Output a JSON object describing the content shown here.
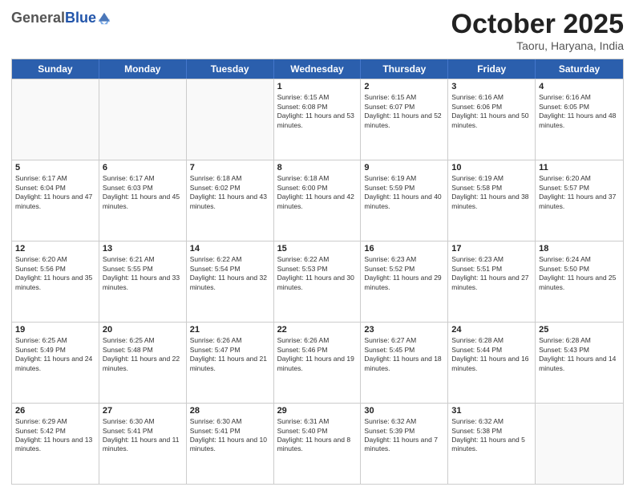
{
  "logo": {
    "general": "General",
    "blue": "Blue"
  },
  "header": {
    "month": "October 2025",
    "location": "Taoru, Haryana, India"
  },
  "weekdays": [
    "Sunday",
    "Monday",
    "Tuesday",
    "Wednesday",
    "Thursday",
    "Friday",
    "Saturday"
  ],
  "rows": [
    [
      {
        "day": "",
        "sunrise": "",
        "sunset": "",
        "daylight": ""
      },
      {
        "day": "",
        "sunrise": "",
        "sunset": "",
        "daylight": ""
      },
      {
        "day": "",
        "sunrise": "",
        "sunset": "",
        "daylight": ""
      },
      {
        "day": "1",
        "sunrise": "Sunrise: 6:15 AM",
        "sunset": "Sunset: 6:08 PM",
        "daylight": "Daylight: 11 hours and 53 minutes."
      },
      {
        "day": "2",
        "sunrise": "Sunrise: 6:15 AM",
        "sunset": "Sunset: 6:07 PM",
        "daylight": "Daylight: 11 hours and 52 minutes."
      },
      {
        "day": "3",
        "sunrise": "Sunrise: 6:16 AM",
        "sunset": "Sunset: 6:06 PM",
        "daylight": "Daylight: 11 hours and 50 minutes."
      },
      {
        "day": "4",
        "sunrise": "Sunrise: 6:16 AM",
        "sunset": "Sunset: 6:05 PM",
        "daylight": "Daylight: 11 hours and 48 minutes."
      }
    ],
    [
      {
        "day": "5",
        "sunrise": "Sunrise: 6:17 AM",
        "sunset": "Sunset: 6:04 PM",
        "daylight": "Daylight: 11 hours and 47 minutes."
      },
      {
        "day": "6",
        "sunrise": "Sunrise: 6:17 AM",
        "sunset": "Sunset: 6:03 PM",
        "daylight": "Daylight: 11 hours and 45 minutes."
      },
      {
        "day": "7",
        "sunrise": "Sunrise: 6:18 AM",
        "sunset": "Sunset: 6:02 PM",
        "daylight": "Daylight: 11 hours and 43 minutes."
      },
      {
        "day": "8",
        "sunrise": "Sunrise: 6:18 AM",
        "sunset": "Sunset: 6:00 PM",
        "daylight": "Daylight: 11 hours and 42 minutes."
      },
      {
        "day": "9",
        "sunrise": "Sunrise: 6:19 AM",
        "sunset": "Sunset: 5:59 PM",
        "daylight": "Daylight: 11 hours and 40 minutes."
      },
      {
        "day": "10",
        "sunrise": "Sunrise: 6:19 AM",
        "sunset": "Sunset: 5:58 PM",
        "daylight": "Daylight: 11 hours and 38 minutes."
      },
      {
        "day": "11",
        "sunrise": "Sunrise: 6:20 AM",
        "sunset": "Sunset: 5:57 PM",
        "daylight": "Daylight: 11 hours and 37 minutes."
      }
    ],
    [
      {
        "day": "12",
        "sunrise": "Sunrise: 6:20 AM",
        "sunset": "Sunset: 5:56 PM",
        "daylight": "Daylight: 11 hours and 35 minutes."
      },
      {
        "day": "13",
        "sunrise": "Sunrise: 6:21 AM",
        "sunset": "Sunset: 5:55 PM",
        "daylight": "Daylight: 11 hours and 33 minutes."
      },
      {
        "day": "14",
        "sunrise": "Sunrise: 6:22 AM",
        "sunset": "Sunset: 5:54 PM",
        "daylight": "Daylight: 11 hours and 32 minutes."
      },
      {
        "day": "15",
        "sunrise": "Sunrise: 6:22 AM",
        "sunset": "Sunset: 5:53 PM",
        "daylight": "Daylight: 11 hours and 30 minutes."
      },
      {
        "day": "16",
        "sunrise": "Sunrise: 6:23 AM",
        "sunset": "Sunset: 5:52 PM",
        "daylight": "Daylight: 11 hours and 29 minutes."
      },
      {
        "day": "17",
        "sunrise": "Sunrise: 6:23 AM",
        "sunset": "Sunset: 5:51 PM",
        "daylight": "Daylight: 11 hours and 27 minutes."
      },
      {
        "day": "18",
        "sunrise": "Sunrise: 6:24 AM",
        "sunset": "Sunset: 5:50 PM",
        "daylight": "Daylight: 11 hours and 25 minutes."
      }
    ],
    [
      {
        "day": "19",
        "sunrise": "Sunrise: 6:25 AM",
        "sunset": "Sunset: 5:49 PM",
        "daylight": "Daylight: 11 hours and 24 minutes."
      },
      {
        "day": "20",
        "sunrise": "Sunrise: 6:25 AM",
        "sunset": "Sunset: 5:48 PM",
        "daylight": "Daylight: 11 hours and 22 minutes."
      },
      {
        "day": "21",
        "sunrise": "Sunrise: 6:26 AM",
        "sunset": "Sunset: 5:47 PM",
        "daylight": "Daylight: 11 hours and 21 minutes."
      },
      {
        "day": "22",
        "sunrise": "Sunrise: 6:26 AM",
        "sunset": "Sunset: 5:46 PM",
        "daylight": "Daylight: 11 hours and 19 minutes."
      },
      {
        "day": "23",
        "sunrise": "Sunrise: 6:27 AM",
        "sunset": "Sunset: 5:45 PM",
        "daylight": "Daylight: 11 hours and 18 minutes."
      },
      {
        "day": "24",
        "sunrise": "Sunrise: 6:28 AM",
        "sunset": "Sunset: 5:44 PM",
        "daylight": "Daylight: 11 hours and 16 minutes."
      },
      {
        "day": "25",
        "sunrise": "Sunrise: 6:28 AM",
        "sunset": "Sunset: 5:43 PM",
        "daylight": "Daylight: 11 hours and 14 minutes."
      }
    ],
    [
      {
        "day": "26",
        "sunrise": "Sunrise: 6:29 AM",
        "sunset": "Sunset: 5:42 PM",
        "daylight": "Daylight: 11 hours and 13 minutes."
      },
      {
        "day": "27",
        "sunrise": "Sunrise: 6:30 AM",
        "sunset": "Sunset: 5:41 PM",
        "daylight": "Daylight: 11 hours and 11 minutes."
      },
      {
        "day": "28",
        "sunrise": "Sunrise: 6:30 AM",
        "sunset": "Sunset: 5:41 PM",
        "daylight": "Daylight: 11 hours and 10 minutes."
      },
      {
        "day": "29",
        "sunrise": "Sunrise: 6:31 AM",
        "sunset": "Sunset: 5:40 PM",
        "daylight": "Daylight: 11 hours and 8 minutes."
      },
      {
        "day": "30",
        "sunrise": "Sunrise: 6:32 AM",
        "sunset": "Sunset: 5:39 PM",
        "daylight": "Daylight: 11 hours and 7 minutes."
      },
      {
        "day": "31",
        "sunrise": "Sunrise: 6:32 AM",
        "sunset": "Sunset: 5:38 PM",
        "daylight": "Daylight: 11 hours and 5 minutes."
      },
      {
        "day": "",
        "sunrise": "",
        "sunset": "",
        "daylight": ""
      }
    ]
  ]
}
